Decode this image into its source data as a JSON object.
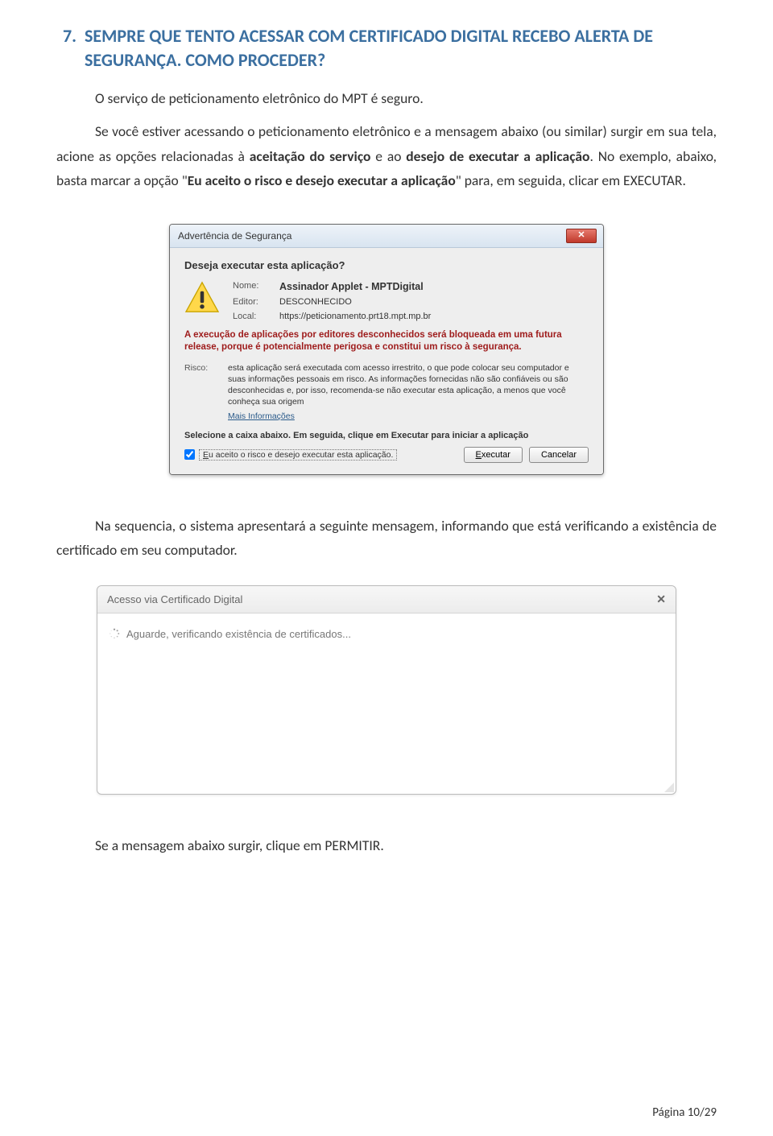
{
  "heading": {
    "number": "7.",
    "text": "SEMPRE QUE TENTO ACESSAR COM CERTIFICADO DIGITAL RECEBO ALERTA DE SEGURANÇA. COMO PROCEDER?"
  },
  "paragraphs": {
    "p1": "O serviço de peticionamento eletrônico do MPT é seguro.",
    "p2_a": "Se você estiver acessando o peticionamento eletrônico e a mensagem abaixo (ou similar) surgir em sua tela, acione as opções relacionadas à ",
    "p2_b": "aceitação do serviço",
    "p2_c": " e ao ",
    "p2_d": "desejo de executar a aplicação",
    "p2_e": ". No exemplo, abaixo, basta marcar a opção \"",
    "p2_f": "Eu aceito o risco e desejo executar a aplicação",
    "p2_g": "\" para, em seguida, clicar em EXECUTAR.",
    "p3": "Na sequencia, o sistema apresentará a seguinte mensagem, informando que está verificando a existência de certificado em seu computador.",
    "p4": "Se a mensagem abaixo surgir, clique em PERMITIR."
  },
  "dialog": {
    "title": "Advertência de Segurança",
    "question": "Deseja executar esta aplicação?",
    "nome_label": "Nome:",
    "nome_value": "Assinador Applet - MPTDigital",
    "editor_label": "Editor:",
    "editor_value": "DESCONHECIDO",
    "local_label": "Local:",
    "local_value": "https://peticionamento.prt18.mpt.mp.br",
    "red_text": "A execução de aplicações por editores desconhecidos será bloqueada em uma futura release, porque é potencialmente perigosa e constitui um risco à segurança.",
    "risk_label": "Risco:",
    "risk_text": "esta aplicação será executada com acesso irrestrito, o que pode colocar seu computador e suas informações pessoais em risco. As informações fornecidas não são confiáveis ou são desconhecidas e, por isso, recomenda-se não executar esta aplicação, a menos que você conheça sua origem",
    "more_info": "Mais Informações",
    "select_text": "Selecione a caixa abaixo. Em seguida, clique em Executar para iniciar a aplicação",
    "checkbox_prefix": "E",
    "checkbox_label": "u aceito o risco e desejo executar esta aplicação.",
    "exec_prefix": "E",
    "exec_rest": "xecutar",
    "cancel_label": "Cancelar"
  },
  "cert_modal": {
    "title": "Acesso via Certificado Digital",
    "message": "Aguarde, verificando existência de certificados..."
  },
  "footer": {
    "text": "Página 10/29"
  }
}
